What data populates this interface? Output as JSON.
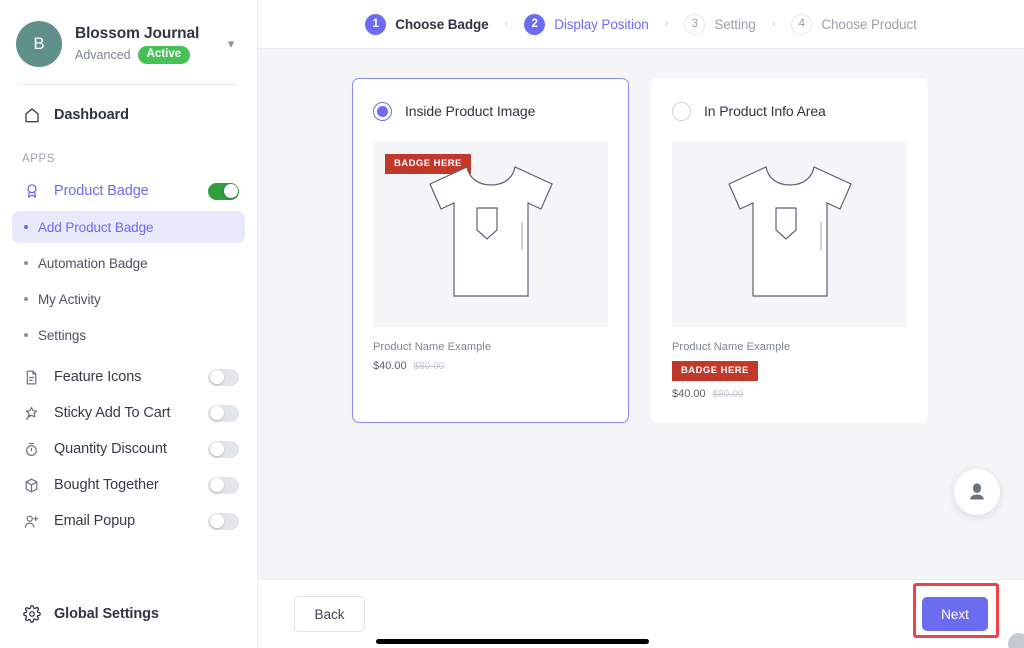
{
  "sidebar": {
    "store": {
      "initial": "B",
      "name": "Blossom Journal",
      "plan": "Advanced",
      "status": "Active"
    },
    "dashboard_label": "Dashboard",
    "section_label": "APPS",
    "product_badge": {
      "label": "Product Badge",
      "enabled": true,
      "sub_items": [
        {
          "label": "Add Product Badge",
          "selected": true
        },
        {
          "label": "Automation Badge",
          "selected": false
        },
        {
          "label": "My Activity",
          "selected": false
        },
        {
          "label": "Settings",
          "selected": false
        }
      ]
    },
    "apps": [
      {
        "label": "Feature Icons",
        "icon": "document-icon",
        "enabled": false
      },
      {
        "label": "Sticky Add To Cart",
        "icon": "pin-icon",
        "enabled": false
      },
      {
        "label": "Quantity Discount",
        "icon": "timer-icon",
        "enabled": false
      },
      {
        "label": "Bought Together",
        "icon": "box-icon",
        "enabled": false
      },
      {
        "label": "Email Popup",
        "icon": "user-add-icon",
        "enabled": false
      }
    ],
    "global_settings_label": "Global Settings"
  },
  "stepper": {
    "steps": [
      {
        "num": "1",
        "label": "Choose Badge",
        "state": "done"
      },
      {
        "num": "2",
        "label": "Display Position",
        "state": "current"
      },
      {
        "num": "3",
        "label": "Setting",
        "state": "todo"
      },
      {
        "num": "4",
        "label": "Choose Product",
        "state": "todo"
      }
    ],
    "separator": "›"
  },
  "options": [
    {
      "title": "Inside Product Image",
      "selected": true,
      "badge_text": "BADGE HERE",
      "badge_position": "image",
      "product_name": "Product Name Example",
      "price": "$40.00",
      "compare_price": "$80.00"
    },
    {
      "title": "In Product Info Area",
      "selected": false,
      "badge_text": "BADGE HERE",
      "badge_position": "info",
      "product_name": "Product Name Example",
      "price": "$40.00",
      "compare_price": "$80.00"
    }
  ],
  "footer": {
    "back_label": "Back",
    "next_label": "Next"
  },
  "colors": {
    "accent": "#6c6cf0",
    "badge_red": "#c0392b",
    "toggle_green": "#2e9e3e",
    "status_green": "#46c157",
    "highlight_red": "#f0404a"
  }
}
